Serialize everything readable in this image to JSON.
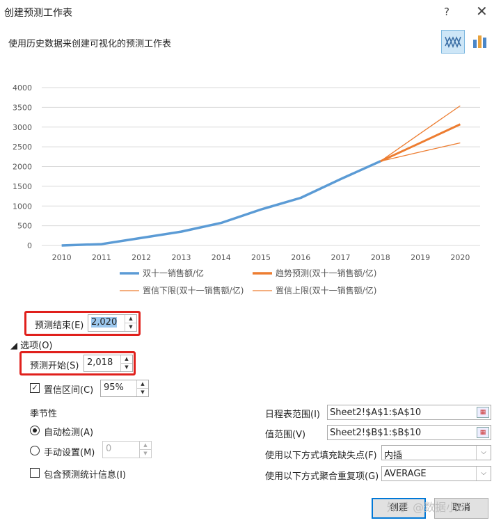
{
  "window": {
    "title": "创建预测工作表",
    "help": "?",
    "close": "✕"
  },
  "subtitle": "使用历史数据来创建可视化的预测工作表",
  "chart_type_icons": [
    "line-chart-icon",
    "bar-chart-icon"
  ],
  "chart_data": {
    "type": "line",
    "x": [
      "2010",
      "2011",
      "2012",
      "2013",
      "2014",
      "2015",
      "2016",
      "2017",
      "2018",
      "2019",
      "2020"
    ],
    "yticks": [
      "0",
      "500",
      "1000",
      "1500",
      "2000",
      "2500",
      "3000",
      "3500",
      "4000"
    ],
    "ylim": [
      0,
      4000
    ],
    "series": [
      {
        "name": "双十一销售额/亿",
        "color": "#5b9bd5",
        "x": [
          2010,
          2011,
          2012,
          2013,
          2014,
          2015,
          2016,
          2017,
          2018
        ],
        "values": [
          0.5,
          34,
          191,
          350,
          571,
          912,
          1207,
          1682,
          2135
        ]
      },
      {
        "name": "趋势预测(双十一销售额/亿)",
        "color": "#ed7d31",
        "x": [
          2018,
          2019,
          2020
        ],
        "values": [
          2135,
          2600,
          3070
        ]
      },
      {
        "name": "置信下限(双十一销售额/亿)",
        "color": "#ed7d31",
        "x": [
          2018,
          2019,
          2020
        ],
        "values": [
          2135,
          2370,
          2600
        ]
      },
      {
        "name": "置信上限(双十一销售额/亿)",
        "color": "#ed7d31",
        "x": [
          2018,
          2019,
          2020
        ],
        "values": [
          2135,
          2840,
          3540
        ]
      }
    ],
    "legend": "bottom",
    "grid": true
  },
  "forecast_end": {
    "label": "预测结束(E)",
    "value": "2,020"
  },
  "options_toggle": "◢ 选项(O)",
  "forecast_start": {
    "label": "预测开始(S)",
    "value": "2,018"
  },
  "confidence": {
    "label": "置信区间(C)",
    "value": "95%",
    "checked": true
  },
  "seasonality": {
    "heading": "季节性",
    "auto_label": "自动检测(A)",
    "manual_label": "手动设置(M)",
    "manual_value": "0"
  },
  "include_stats": {
    "label": "包含预测统计信息(I)"
  },
  "timeline_range": {
    "label": "日程表范围(I)",
    "value": "Sheet2!$A$1:$A$10"
  },
  "value_range": {
    "label": "值范围(V)",
    "value": "Sheet2!$B$1:$B$10"
  },
  "fill_missing": {
    "label": "使用以下方式填充缺失点(F)",
    "value": "内插"
  },
  "aggregate": {
    "label": "使用以下方式聚合重复项(G)",
    "value": "AVERAGE"
  },
  "buttons": {
    "create": "创建",
    "cancel": "取消"
  },
  "watermark": "知乎 @数据小E"
}
